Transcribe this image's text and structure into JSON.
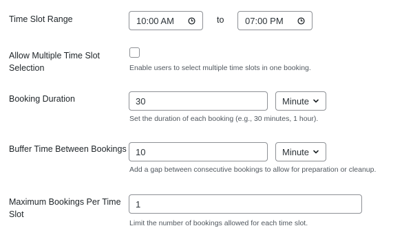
{
  "time_slot_range": {
    "label": "Time Slot Range",
    "start": "10:00 AM",
    "separator": "to",
    "end": "07:00 PM",
    "clock_icon": "clock-icon"
  },
  "multiple_slots": {
    "label": "Allow Multiple Time Slot Selection",
    "checked": false,
    "description": "Enable users to select multiple time slots in one booking."
  },
  "booking_duration": {
    "label": "Booking Duration",
    "value": "30",
    "unit": "Minute",
    "description": "Set the duration of each booking (e.g., 30 minutes, 1 hour)."
  },
  "buffer_time": {
    "label": "Buffer Time Between Bookings",
    "value": "10",
    "unit": "Minute",
    "description": "Add a gap between consecutive bookings to allow for preparation or cleanup."
  },
  "max_bookings": {
    "label": "Maximum Bookings Per Time Slot",
    "value": "1",
    "description": "Limit the number of bookings allowed for each time slot."
  },
  "colors": {
    "text": "#1d2327",
    "description": "#50575e",
    "border": "#8c8f94"
  }
}
